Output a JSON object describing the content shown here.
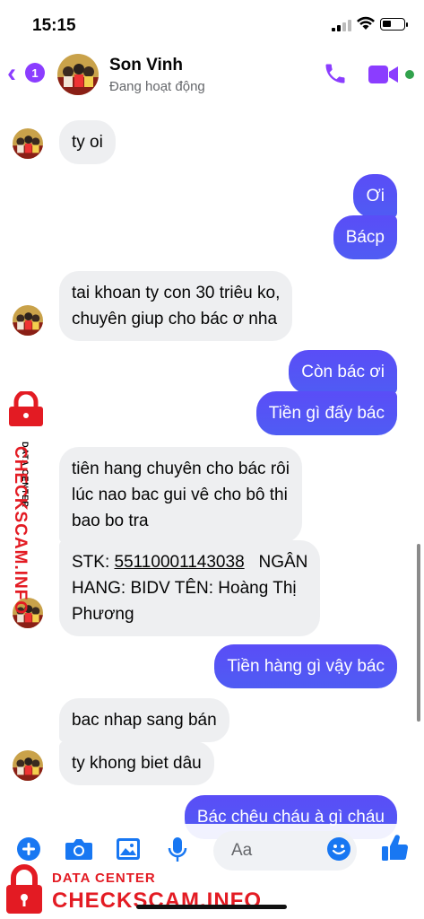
{
  "status_bar": {
    "time": "15:15"
  },
  "header": {
    "back_badge": "1",
    "contact_name": "Son Vinh",
    "contact_status": "Đang hoạt động"
  },
  "messages": [
    {
      "dir": "in",
      "text": "ty oi"
    },
    {
      "dir": "out",
      "text": "Ơi"
    },
    {
      "dir": "out",
      "text": "Bácp"
    },
    {
      "dir": "in",
      "lines": [
        "tai khoan ty con 30 triêu ko,",
        "chuyên giup cho bác ơ nha"
      ]
    },
    {
      "dir": "out",
      "text": "Còn bác ơi"
    },
    {
      "dir": "out",
      "text": "Tiền gì đấy bác"
    },
    {
      "dir": "in",
      "lines": [
        "tiên hang chuyên cho bác rôi",
        "lúc nao bac gui vê cho bô thi",
        "bao bo tra"
      ]
    },
    {
      "dir": "in",
      "stk_label": "STK: ",
      "stk_number": "55110001143038",
      "stk_rest_line1": "NGÂN",
      "lines": [
        "HANG: BIDV TÊN: Hoàng Thị",
        "Phương"
      ]
    },
    {
      "dir": "out",
      "text": "Tiền hàng gì vậy bác"
    },
    {
      "dir": "in",
      "text": "bac nhap sang bán"
    },
    {
      "dir": "in",
      "text": "ty khong biet dâu"
    },
    {
      "dir": "out",
      "text": "Bác chêu cháu à gì cháu"
    }
  ],
  "composer": {
    "placeholder": "Aa"
  },
  "watermark": {
    "sub": "DATA CENTER",
    "brand": "CHECKSCAM.INFO"
  },
  "colors": {
    "accent": "#8b3dff",
    "outgoing_bubble": "#5a4df7",
    "incoming_bubble": "#eeeff1",
    "composer_icon": "#1877f2",
    "watermark_red": "#e31b23"
  },
  "icons": [
    "phone-icon",
    "video-camera-icon",
    "plus-circle-icon",
    "camera-icon",
    "image-icon",
    "microphone-icon",
    "emoji-icon",
    "thumbs-up-icon",
    "lock-icon"
  ]
}
